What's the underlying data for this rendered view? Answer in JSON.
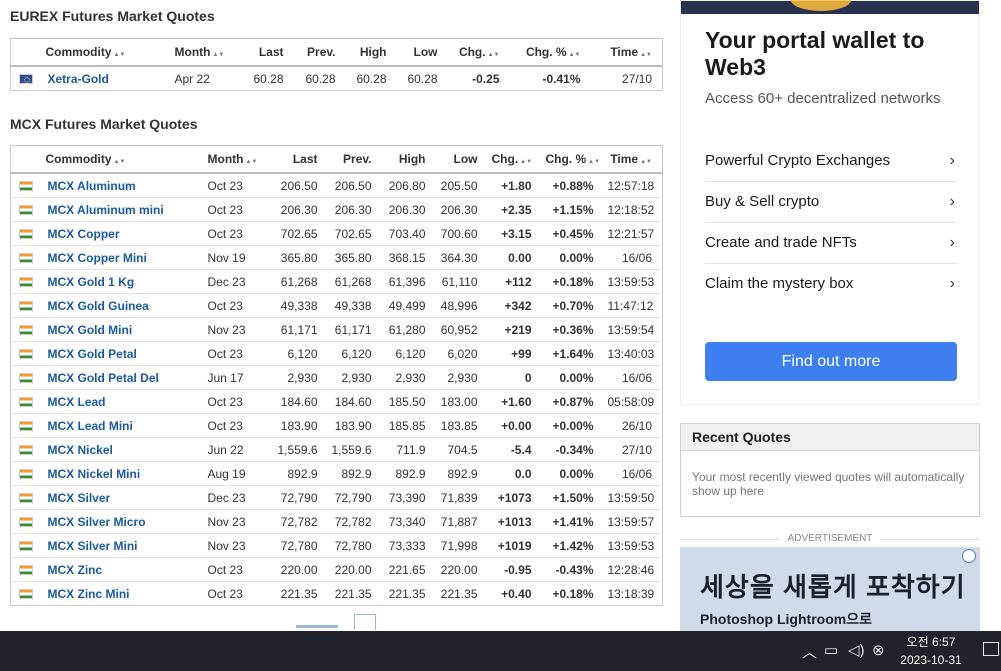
{
  "eurex": {
    "title": "EUREX Futures Market Quotes",
    "headers": [
      "Commodity",
      "Month",
      "Last",
      "Prev.",
      "High",
      "Low",
      "Chg.",
      "Chg. %",
      "Time"
    ],
    "rows": [
      {
        "flag": "eu",
        "name": "Xetra-Gold",
        "month": "Apr 22",
        "last": "60.28",
        "prev": "60.28",
        "high": "60.28",
        "low": "60.28",
        "chg": "-0.25",
        "chgpct": "-0.41%",
        "time": "27/10",
        "dir": "neg"
      }
    ]
  },
  "mcx": {
    "title": "MCX Futures Market Quotes",
    "headers": [
      "Commodity",
      "Month",
      "Last",
      "Prev.",
      "High",
      "Low",
      "Chg.",
      "Chg. %",
      "Time"
    ],
    "rows": [
      {
        "flag": "in",
        "name": "MCX Aluminum",
        "month": "Oct 23",
        "last": "206.50",
        "prev": "206.50",
        "high": "206.80",
        "low": "205.50",
        "chg": "+1.80",
        "chgpct": "+0.88%",
        "time": "12:57:18",
        "dir": "pos"
      },
      {
        "flag": "in",
        "name": "MCX Aluminum mini",
        "month": "Oct 23",
        "last": "206.30",
        "prev": "206.30",
        "high": "206.30",
        "low": "206.30",
        "chg": "+2.35",
        "chgpct": "+1.15%",
        "time": "12:18:52",
        "dir": "pos"
      },
      {
        "flag": "in",
        "name": "MCX Copper",
        "month": "Oct 23",
        "last": "702.65",
        "prev": "702.65",
        "high": "703.40",
        "low": "700.60",
        "chg": "+3.15",
        "chgpct": "+0.45%",
        "time": "12:21:57",
        "dir": "pos"
      },
      {
        "flag": "in",
        "name": "MCX Copper Mini",
        "month": "Nov 19",
        "last": "365.80",
        "prev": "365.80",
        "high": "368.15",
        "low": "364.30",
        "chg": "0.00",
        "chgpct": "0.00%",
        "time": "16/06",
        "dir": "neu"
      },
      {
        "flag": "in",
        "name": "MCX Gold 1 Kg",
        "month": "Dec 23",
        "last": "61,268",
        "prev": "61,268",
        "high": "61,396",
        "low": "61,110",
        "chg": "+112",
        "chgpct": "+0.18%",
        "time": "13:59:53",
        "dir": "pos"
      },
      {
        "flag": "in",
        "name": "MCX Gold Guinea",
        "month": "Oct 23",
        "last": "49,338",
        "prev": "49,338",
        "high": "49,499",
        "low": "48,996",
        "chg": "+342",
        "chgpct": "+0.70%",
        "time": "11:47:12",
        "dir": "pos"
      },
      {
        "flag": "in",
        "name": "MCX Gold Mini",
        "month": "Nov 23",
        "last": "61,171",
        "prev": "61,171",
        "high": "61,280",
        "low": "60,952",
        "chg": "+219",
        "chgpct": "+0.36%",
        "time": "13:59:54",
        "dir": "pos"
      },
      {
        "flag": "in",
        "name": "MCX Gold Petal",
        "month": "Oct 23",
        "last": "6,120",
        "prev": "6,120",
        "high": "6,120",
        "low": "6,020",
        "chg": "+99",
        "chgpct": "+1.64%",
        "time": "13:40:03",
        "dir": "pos"
      },
      {
        "flag": "in",
        "name": "MCX Gold Petal Del",
        "month": "Jun 17",
        "last": "2,930",
        "prev": "2,930",
        "high": "2,930",
        "low": "2,930",
        "chg": "0",
        "chgpct": "0.00%",
        "time": "16/06",
        "dir": "neu"
      },
      {
        "flag": "in",
        "name": "MCX Lead",
        "month": "Oct 23",
        "last": "184.60",
        "prev": "184.60",
        "high": "185.50",
        "low": "183.00",
        "chg": "+1.60",
        "chgpct": "+0.87%",
        "time": "05:58:09",
        "dir": "pos"
      },
      {
        "flag": "in",
        "name": "MCX Lead Mini",
        "month": "Oct 23",
        "last": "183.90",
        "prev": "183.90",
        "high": "185.85",
        "low": "183.85",
        "chg": "+0.00",
        "chgpct": "+0.00%",
        "time": "26/10",
        "dir": "pos"
      },
      {
        "flag": "in",
        "name": "MCX Nickel",
        "month": "Jun 22",
        "last": "1,559.6",
        "prev": "1,559.6",
        "high": "711.9",
        "low": "704.5",
        "chg": "-5.4",
        "chgpct": "-0.34%",
        "time": "27/10",
        "dir": "neg"
      },
      {
        "flag": "in",
        "name": "MCX Nickel Mini",
        "month": "Aug 19",
        "last": "892.9",
        "prev": "892.9",
        "high": "892.9",
        "low": "892.9",
        "chg": "0.0",
        "chgpct": "0.00%",
        "time": "16/06",
        "dir": "neu"
      },
      {
        "flag": "in",
        "name": "MCX Silver",
        "month": "Dec 23",
        "last": "72,790",
        "prev": "72,790",
        "high": "73,390",
        "low": "71,839",
        "chg": "+1073",
        "chgpct": "+1.50%",
        "time": "13:59:50",
        "dir": "pos"
      },
      {
        "flag": "in",
        "name": "MCX Silver Micro",
        "month": "Nov 23",
        "last": "72,782",
        "prev": "72,782",
        "high": "73,340",
        "low": "71,887",
        "chg": "+1013",
        "chgpct": "+1.41%",
        "time": "13:59:57",
        "dir": "pos"
      },
      {
        "flag": "in",
        "name": "MCX Silver Mini",
        "month": "Nov 23",
        "last": "72,780",
        "prev": "72,780",
        "high": "73,333",
        "low": "71,998",
        "chg": "+1019",
        "chgpct": "+1.42%",
        "time": "13:59:53",
        "dir": "pos"
      },
      {
        "flag": "in",
        "name": "MCX Zinc",
        "month": "Oct 23",
        "last": "220.00",
        "prev": "220.00",
        "high": "221.65",
        "low": "220.00",
        "chg": "-0.95",
        "chgpct": "-0.43%",
        "time": "12:28:46",
        "dir": "neg"
      },
      {
        "flag": "in",
        "name": "MCX Zinc Mini",
        "month": "Oct 23",
        "last": "221.35",
        "prev": "221.35",
        "high": "221.35",
        "low": "221.35",
        "chg": "+0.40",
        "chgpct": "+0.18%",
        "time": "13:18:39",
        "dir": "pos"
      }
    ]
  },
  "ad_wallet": {
    "headline": "Your portal wallet to Web3",
    "subtitle": "Access 60+ decentralized networks",
    "items": [
      "Powerful Crypto Exchanges",
      "Buy & Sell crypto",
      "Create and trade NFTs",
      "Claim the mystery box"
    ],
    "cta": "Find out more",
    "accent_color": "#3d7ff0"
  },
  "recent_quotes": {
    "title": "Recent Quotes",
    "body": "Your most recently viewed quotes will automatically show up here"
  },
  "advertisement_label": "ADVERTISEMENT",
  "ad_lightroom": {
    "headline": "세상을 새롭게 포착하기",
    "sub": "Photoshop Lightroom으로"
  },
  "taskbar": {
    "time": "오전 6:57",
    "date": "2023-10-31",
    "icons": [
      "chevron-up-icon",
      "network-icon",
      "volume-icon",
      "close-circle-icon",
      "notification-icon"
    ]
  },
  "colors": {
    "positive": "#0a9a1f",
    "negative": "#e02020",
    "link": "#1a5aa6"
  }
}
